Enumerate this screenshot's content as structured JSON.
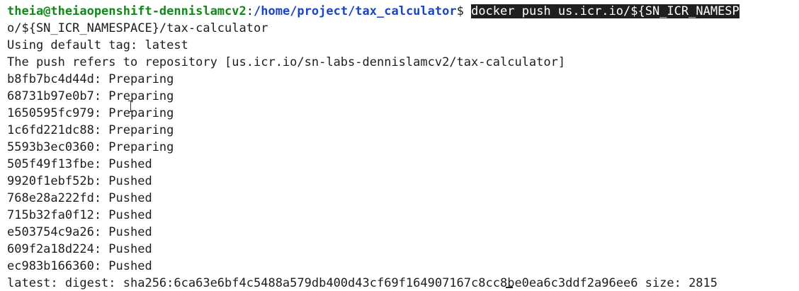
{
  "prompt": {
    "user_host": "theia@theiaopenshift-dennislamcv2",
    "separator": ":",
    "path": "/home/project/tax_calculator",
    "symbol": "$ ",
    "command_first": "docker push us.icr.io/${SN_ICR_NAMESP",
    "command_wrap": "o/${SN_ICR_NAMESPACE}/tax-calculator"
  },
  "output": {
    "default_tag": "Using default tag: latest",
    "refers_to": "The push refers to repository [us.icr.io/sn-labs-dennislamcv2/tax-calculator]",
    "layers": [
      "b8fb7bc4d44d: Preparing",
      "68731b97e0b7: Preparing",
      "1650595fc979: Preparing",
      "1c6fd221dc88: Preparing",
      "5593b3ec0360: Preparing",
      "505f49f13fbe: Pushed",
      "9920f1ebf52b: Pushed",
      "768e28a222fd: Pushed",
      "715b32fa0f12: Pushed",
      "e503754c9a26: Pushed",
      "609f2a18d224: Pushed",
      "ec983b166360: Pushed"
    ],
    "digest": "latest: digest: sha256:6ca63e6bf4c5488a579db400d43cf69f164907167c8cc8be0ea6c3ddf2a96ee6 size: 2815"
  },
  "colors": {
    "user_host": "#0f8a1a",
    "path": "#1a45c7",
    "text": "#1e1e1e",
    "highlight_bg": "#1f1f1f",
    "highlight_fg": "#ffffff",
    "background": "#ffffff"
  }
}
